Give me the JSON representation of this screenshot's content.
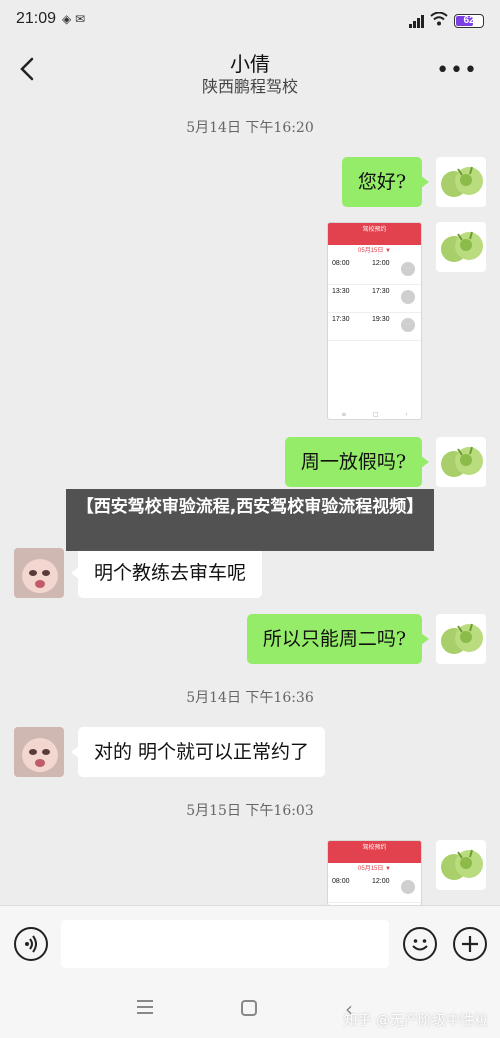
{
  "status_bar": {
    "time": "21:09",
    "left_icons": "◈  ✉",
    "battery": "62"
  },
  "header": {
    "title": "小倩",
    "subtitle": "陕西鹏程驾校",
    "more": "•••"
  },
  "messages": {
    "ts1": "5月14日 下午16:20",
    "m1": "您好?",
    "m3": "周一放假吗?",
    "m4": "明个教练去审车呢",
    "m5": "所以只能周二吗?",
    "ts2": "5月14日 下午16:36",
    "m6": "对的 明个就可以正常约了",
    "ts3": "5月15日 下午16:03"
  },
  "screenshot_card": {
    "header": "驾校预约",
    "date": "05月15日 ▼",
    "rows": [
      {
        "start": "08:00",
        "end": "12:00"
      },
      {
        "start": "13:30",
        "end": "17:30"
      },
      {
        "start": "17:30",
        "end": "19:30"
      }
    ]
  },
  "overlay": {
    "text": "【西安驾校审验流程,西安驾校审验流程视频】"
  },
  "input_bar": {
    "placeholder": ""
  },
  "watermark": "知乎 @无产阶级中性粒",
  "colors": {
    "outgoing": "#95ec69",
    "incoming": "#ffffff",
    "background": "#ededed",
    "accent_red": "#e2424d"
  }
}
